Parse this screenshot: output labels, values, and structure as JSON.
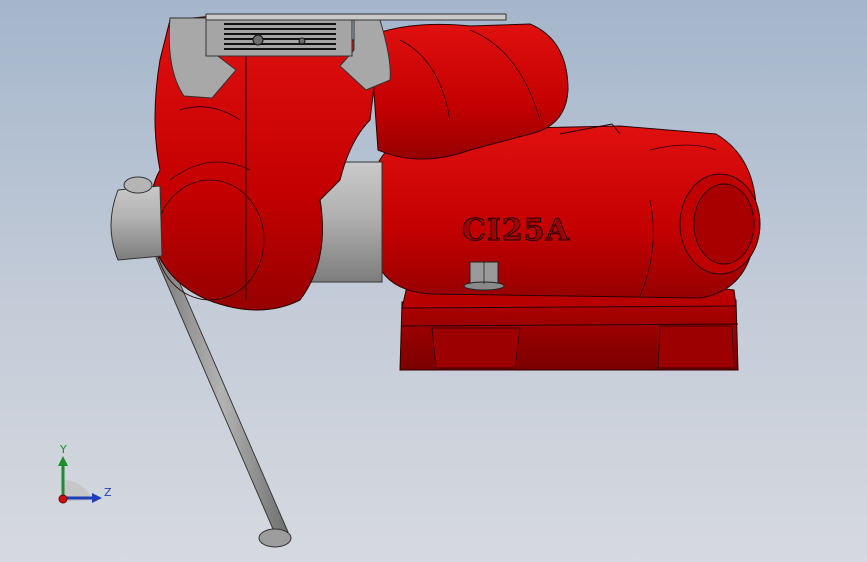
{
  "viewport": {
    "background": "gradient-blue-grey",
    "model_color": "#c40000",
    "jaw_insert_color": "#a8a8a8"
  },
  "model": {
    "name": "bench-vise",
    "engraving": "CI25A"
  },
  "triad": {
    "y_label": "Y",
    "z_label": "Z",
    "y_color": "#1a8f2a",
    "z_color": "#1f3fb8"
  }
}
